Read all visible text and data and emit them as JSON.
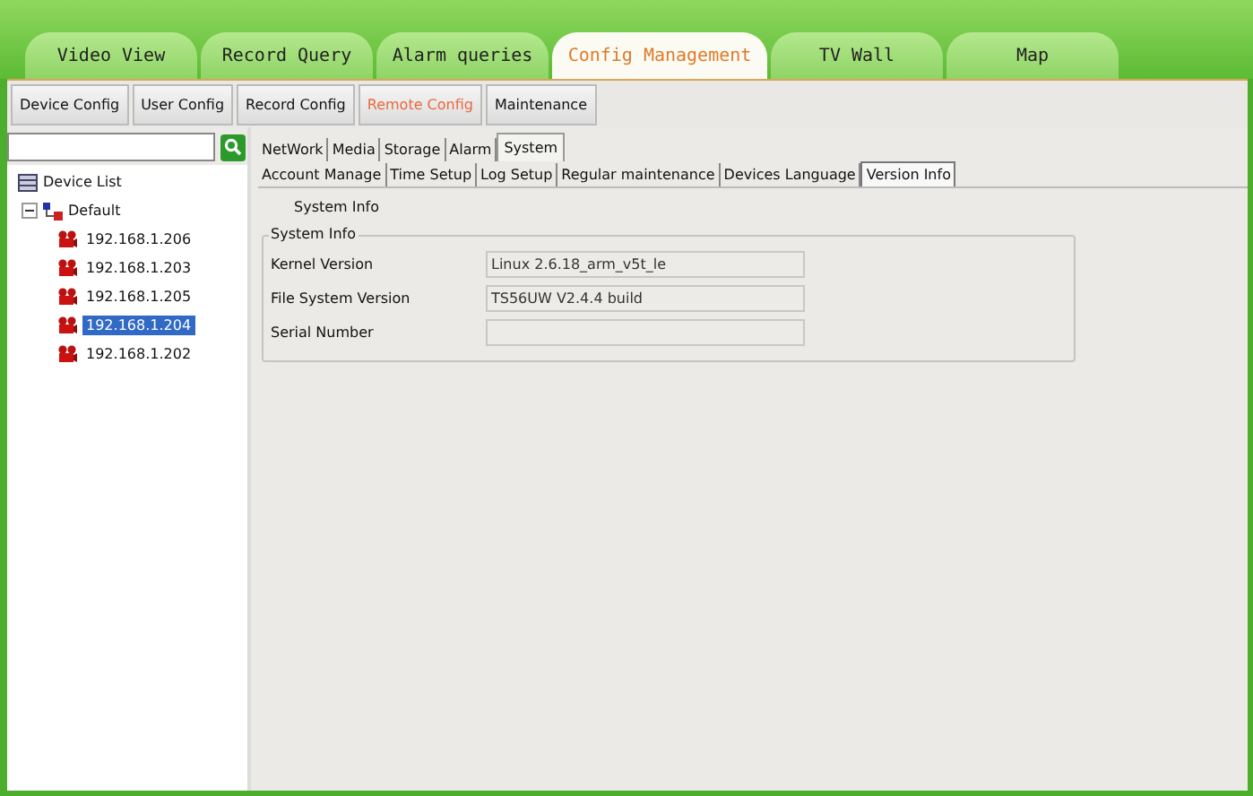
{
  "main_tabs": [
    {
      "label": "Video View",
      "selected": false
    },
    {
      "label": "Record Query",
      "selected": false
    },
    {
      "label": "Alarm queries",
      "selected": false
    },
    {
      "label": "Config Management",
      "selected": true
    },
    {
      "label": "TV Wall",
      "selected": false
    },
    {
      "label": "Map",
      "selected": false
    }
  ],
  "sub_tabs": [
    {
      "label": "Device Config",
      "selected": false
    },
    {
      "label": "User Config",
      "selected": false
    },
    {
      "label": "Record Config",
      "selected": false
    },
    {
      "label": "Remote Config",
      "selected": true
    },
    {
      "label": "Maintenance",
      "selected": false
    }
  ],
  "tree": {
    "label": "Device List",
    "children": [
      {
        "label": "Default",
        "expanded": true,
        "children": [
          {
            "label": "192.168.1.206",
            "selected": false
          },
          {
            "label": "192.168.1.203",
            "selected": false
          },
          {
            "label": "192.168.1.205",
            "selected": false
          },
          {
            "label": "192.168.1.204",
            "selected": true
          },
          {
            "label": "192.168.1.202",
            "selected": false
          }
        ]
      }
    ]
  },
  "category_tabs": [
    {
      "label": "NetWork",
      "selected": false
    },
    {
      "label": "Media",
      "selected": false
    },
    {
      "label": "Storage",
      "selected": false
    },
    {
      "label": "Alarm",
      "selected": false
    },
    {
      "label": "System",
      "selected": true
    }
  ],
  "system_tabs": [
    {
      "label": "Account Manage",
      "selected": false
    },
    {
      "label": "Time Setup",
      "selected": false
    },
    {
      "label": "Log Setup",
      "selected": false
    },
    {
      "label": "Regular maintenance",
      "selected": false
    },
    {
      "label": "Devices Language",
      "selected": false
    },
    {
      "label": "Version Info",
      "selected": true
    }
  ],
  "section_title": "System Info",
  "group": {
    "title": "System Info",
    "fields": [
      {
        "label": "Kernel Version",
        "value": "Linux 2.6.18_arm_v5t_le"
      },
      {
        "label": "File System Version",
        "value": "TS56UW V2.4.4 build"
      },
      {
        "label": "Serial Number"
      }
    ]
  }
}
